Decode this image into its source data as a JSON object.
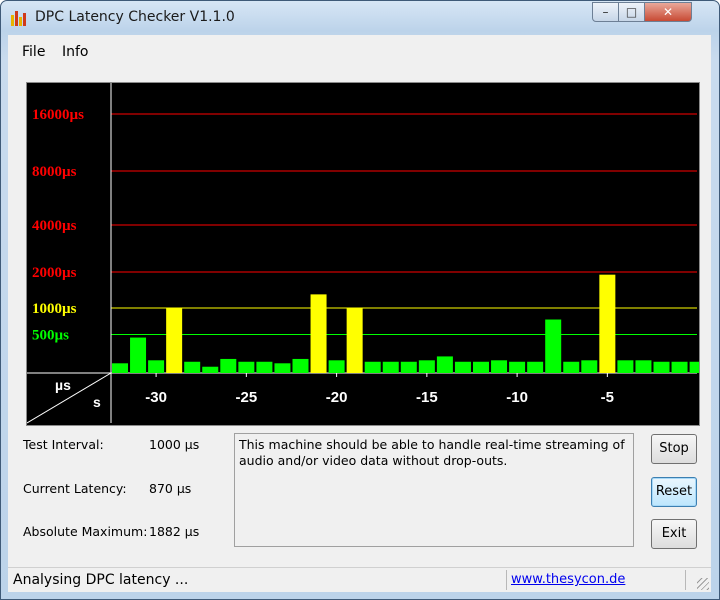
{
  "window": {
    "title": "DPC Latency Checker V1.1.0",
    "controls": {
      "minimize": "–",
      "maximize": "□",
      "close": "✕"
    }
  },
  "menu": {
    "items": [
      "File",
      "Info"
    ]
  },
  "chart_data": {
    "type": "bar",
    "y_scale": "log",
    "y_ticks": [
      {
        "value": 500,
        "label": "500µs",
        "color": "#00ff00"
      },
      {
        "value": 1000,
        "label": "1000µs",
        "color": "#ffff00"
      },
      {
        "value": 2000,
        "label": "2000µs",
        "color": "#ff0000"
      },
      {
        "value": 4000,
        "label": "4000µs",
        "color": "#ff0000"
      },
      {
        "value": 8000,
        "label": "8000µs",
        "color": "#ff0000"
      },
      {
        "value": 16000,
        "label": "16000µs",
        "color": "#ff0000"
      }
    ],
    "x_ticks": [
      -30,
      -25,
      -20,
      -15,
      -10,
      -5
    ],
    "x_tick_labels": [
      "-30",
      "-25",
      "-20",
      "-15",
      "-10",
      "-5"
    ],
    "corner_labels": {
      "y_unit": "µs",
      "x_unit": "s"
    },
    "x": [
      -32,
      -31,
      -30,
      -29,
      -28,
      -27,
      -26,
      -25,
      -24,
      -23,
      -22,
      -21,
      -20,
      -19,
      -18,
      -17,
      -16,
      -15,
      -14,
      -13,
      -12,
      -11,
      -10,
      -9,
      -8,
      -7,
      -6,
      -5,
      -4,
      -3,
      -2,
      -1,
      0
    ],
    "values": [
      150,
      440,
      170,
      1000,
      160,
      130,
      180,
      160,
      160,
      150,
      180,
      1300,
      170,
      1000,
      160,
      160,
      160,
      170,
      200,
      160,
      160,
      170,
      160,
      160,
      740,
      160,
      170,
      1900,
      170,
      170,
      160,
      160,
      160
    ],
    "bar_colors": {
      "normal": "#00ff00",
      "warning": "#ffff00"
    },
    "threshold_color": "#ffff00"
  },
  "stats": {
    "test_interval": {
      "label": "Test Interval:",
      "value": "1000 µs"
    },
    "current_latency": {
      "label": "Current Latency:",
      "value": "870 µs"
    },
    "absolute_maximum": {
      "label": "Absolute Maximum:",
      "value": "1882 µs"
    }
  },
  "message": "This machine should be able to handle real-time streaming of audio and/or video data without drop-outs.",
  "buttons": {
    "stop": "Stop",
    "reset": "Reset",
    "exit": "Exit"
  },
  "status": {
    "text": "Analysing DPC latency ...",
    "link": "www.thesycon.de"
  }
}
